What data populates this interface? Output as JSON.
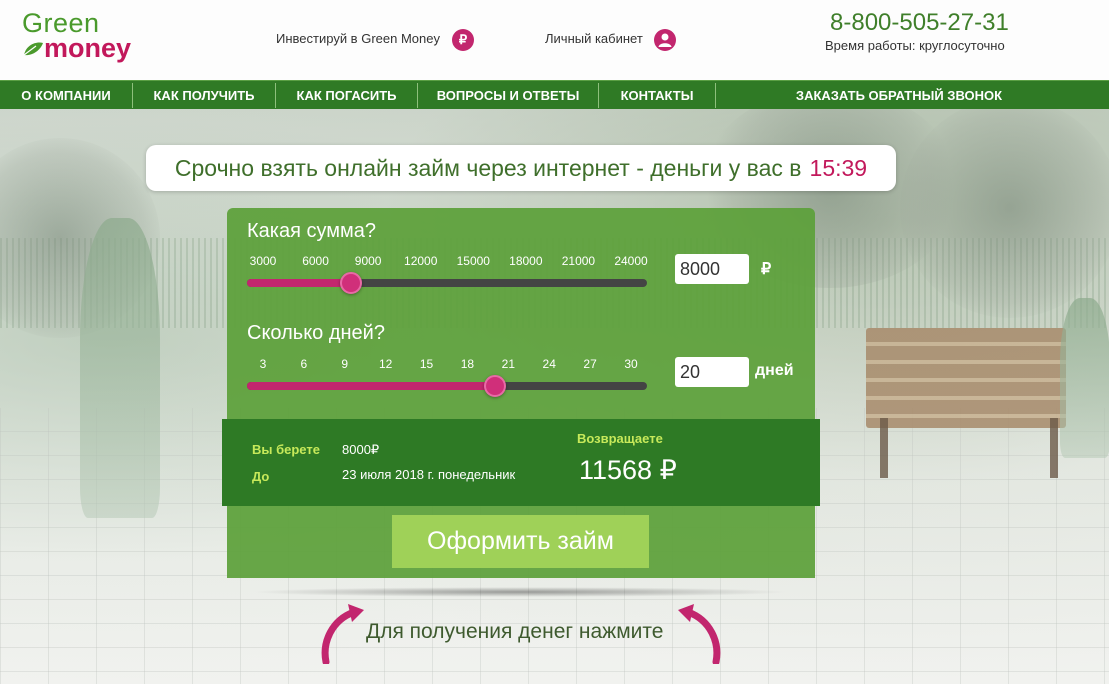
{
  "logo": {
    "line1": "Green",
    "line2": "money"
  },
  "header": {
    "invest_label": "Инвестируй в Green Money",
    "invest_icon": "ruble-icon",
    "invest_icon_glyph": "₽",
    "account_label": "Личный кабинет",
    "account_icon": "user-icon",
    "phone": "8-800-505-27-31",
    "work_hours": "Время работы: круглосуточно"
  },
  "nav": {
    "items": [
      "О КОМПАНИИ",
      "КАК ПОЛУЧИТЬ",
      "КАК ПОГАСИТЬ",
      "ВОПРОСЫ И ОТВЕТЫ",
      "КОНТАКТЫ",
      "ЗАКАЗАТЬ ОБРАТНЫЙ ЗВОНОК"
    ]
  },
  "headline": {
    "text": "Срочно взять онлайн займ через интернет - деньги у вас в",
    "time": "15:39"
  },
  "calculator": {
    "amount": {
      "title": "Какая сумма?",
      "ticks": [
        "3000",
        "6000",
        "9000",
        "12000",
        "15000",
        "18000",
        "21000",
        "24000"
      ],
      "value": "8000",
      "unit": "₽",
      "min": 3000,
      "max": 24000
    },
    "days": {
      "title": "Сколько дней?",
      "ticks": [
        "3",
        "6",
        "9",
        "12",
        "15",
        "18",
        "21",
        "24",
        "27",
        "30"
      ],
      "value": "20",
      "unit": "дней",
      "min": 3,
      "max": 30
    },
    "summary": {
      "take_label": "Вы берете",
      "take_value": "8000₽",
      "until_label": "До",
      "until_value": "23 июля 2018 г. понедельник",
      "return_label": "Возвращаете",
      "return_value": "11568 ₽"
    },
    "apply_label": "Оформить займ"
  },
  "hint": "Для получения денег нажмите",
  "colors": {
    "brand_green": "#2f7a25",
    "accent_pink": "#c2266e",
    "panel_green": "#5ca03a",
    "button_green": "#9fd158"
  }
}
